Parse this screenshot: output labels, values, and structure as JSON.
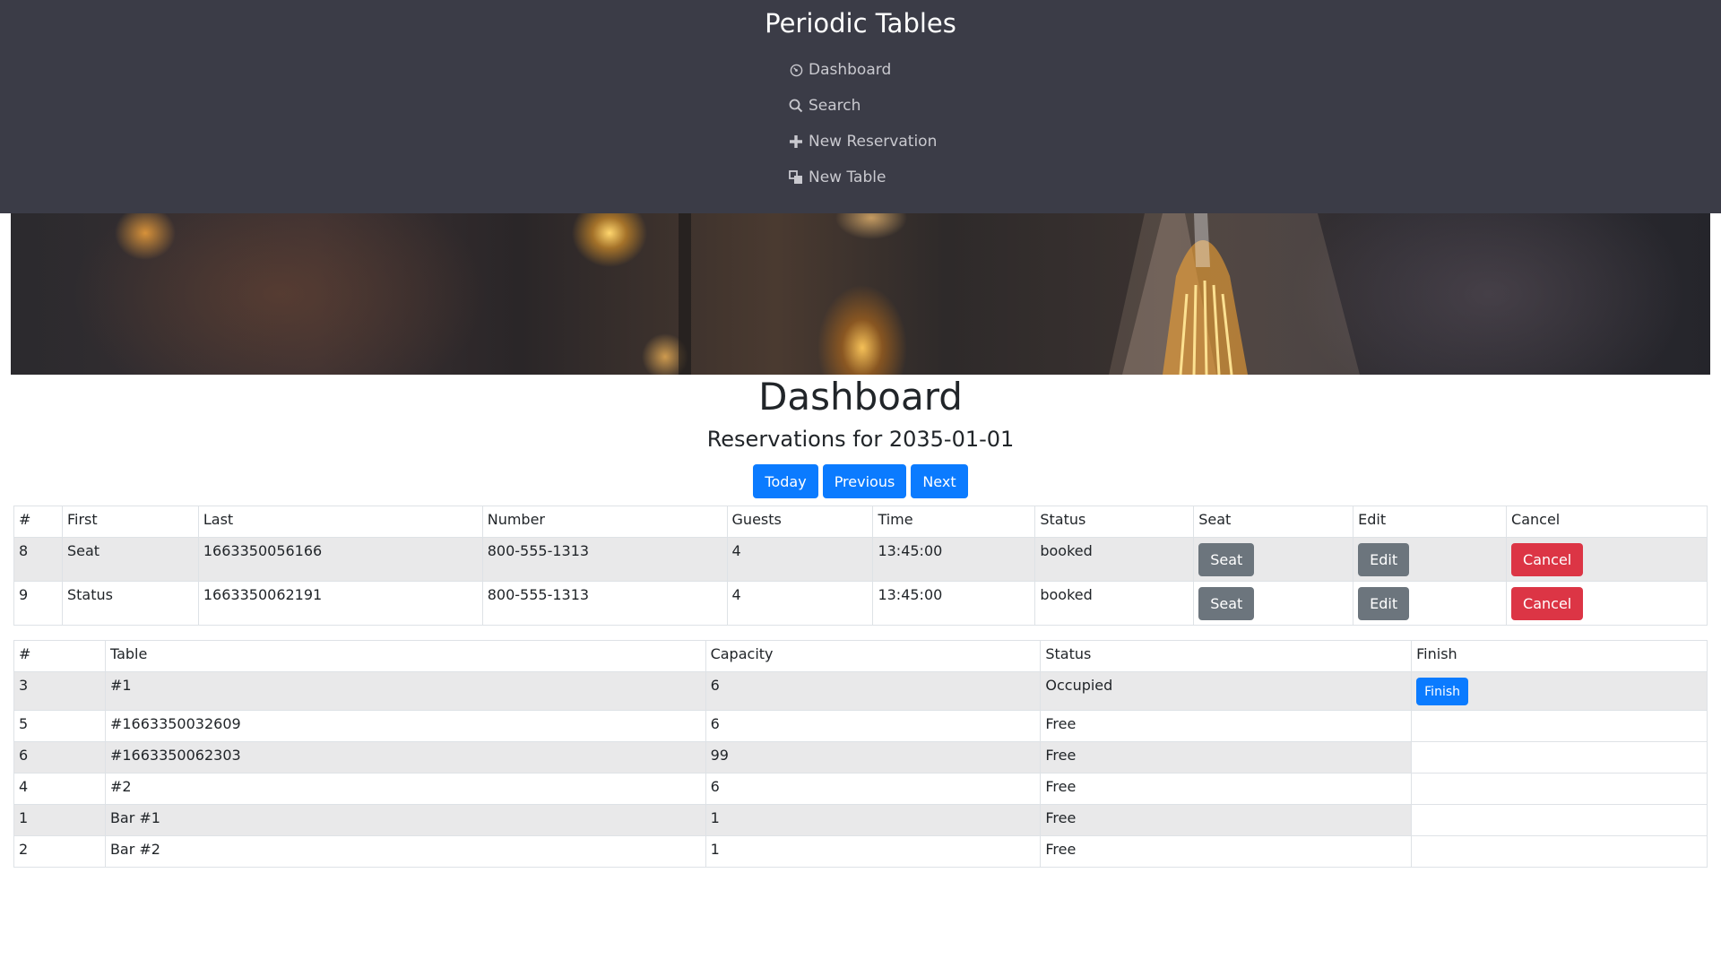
{
  "header": {
    "brand": "Periodic Tables",
    "nav": [
      {
        "label": "Dashboard",
        "icon": "dashboard-icon"
      },
      {
        "label": "Search",
        "icon": "search-icon"
      },
      {
        "label": "New Reservation",
        "icon": "plus-icon"
      },
      {
        "label": "New Table",
        "icon": "layers-icon"
      }
    ]
  },
  "main": {
    "title": "Dashboard",
    "subtitle": "Reservations for 2035-01-01",
    "date_buttons": {
      "today": "Today",
      "previous": "Previous",
      "next": "Next"
    }
  },
  "reservations": {
    "columns": [
      "#",
      "First",
      "Last",
      "Number",
      "Guests",
      "Time",
      "Status",
      "Seat",
      "Edit",
      "Cancel"
    ],
    "rows": [
      {
        "id": "8",
        "first": "Seat",
        "last": "1663350056166",
        "number": "800-555-1313",
        "guests": "4",
        "time": "13:45:00",
        "status": "booked",
        "seat": "Seat",
        "edit": "Edit",
        "cancel": "Cancel"
      },
      {
        "id": "9",
        "first": "Status",
        "last": "1663350062191",
        "number": "800-555-1313",
        "guests": "4",
        "time": "13:45:00",
        "status": "booked",
        "seat": "Seat",
        "edit": "Edit",
        "cancel": "Cancel"
      }
    ]
  },
  "tables": {
    "columns": [
      "#",
      "Table",
      "Capacity",
      "Status",
      "Finish"
    ],
    "rows": [
      {
        "id": "3",
        "table": "#1",
        "capacity": "6",
        "status": "Occupied",
        "finish": "Finish"
      },
      {
        "id": "5",
        "table": "#1663350032609",
        "capacity": "6",
        "status": "Free",
        "finish": ""
      },
      {
        "id": "6",
        "table": "#1663350062303",
        "capacity": "99",
        "status": "Free",
        "finish": ""
      },
      {
        "id": "4",
        "table": "#2",
        "capacity": "6",
        "status": "Free",
        "finish": ""
      },
      {
        "id": "1",
        "table": "Bar #1",
        "capacity": "1",
        "status": "Free",
        "finish": ""
      },
      {
        "id": "2",
        "table": "Bar #2",
        "capacity": "1",
        "status": "Free",
        "finish": ""
      }
    ]
  },
  "colors": {
    "header_bg": "#3b3c47",
    "primary": "#0b7bff",
    "secondary": "#6c757d",
    "danger": "#dc3545"
  }
}
